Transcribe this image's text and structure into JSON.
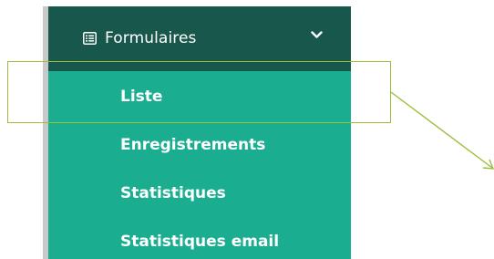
{
  "menu": {
    "header": {
      "label": "Formulaires",
      "icon": "list-form-icon",
      "toggle_icon": "chevron-down-icon",
      "expanded": true
    },
    "items": [
      {
        "label": "Liste",
        "highlighted": true
      },
      {
        "label": "Enregistrements"
      },
      {
        "label": "Statistiques"
      },
      {
        "label": "Statistiques email"
      }
    ]
  },
  "colors": {
    "header_bg": "#18574b",
    "menu_bg": "#1aad90",
    "text": "#ffffff",
    "annotation": "#9bbf3c"
  }
}
